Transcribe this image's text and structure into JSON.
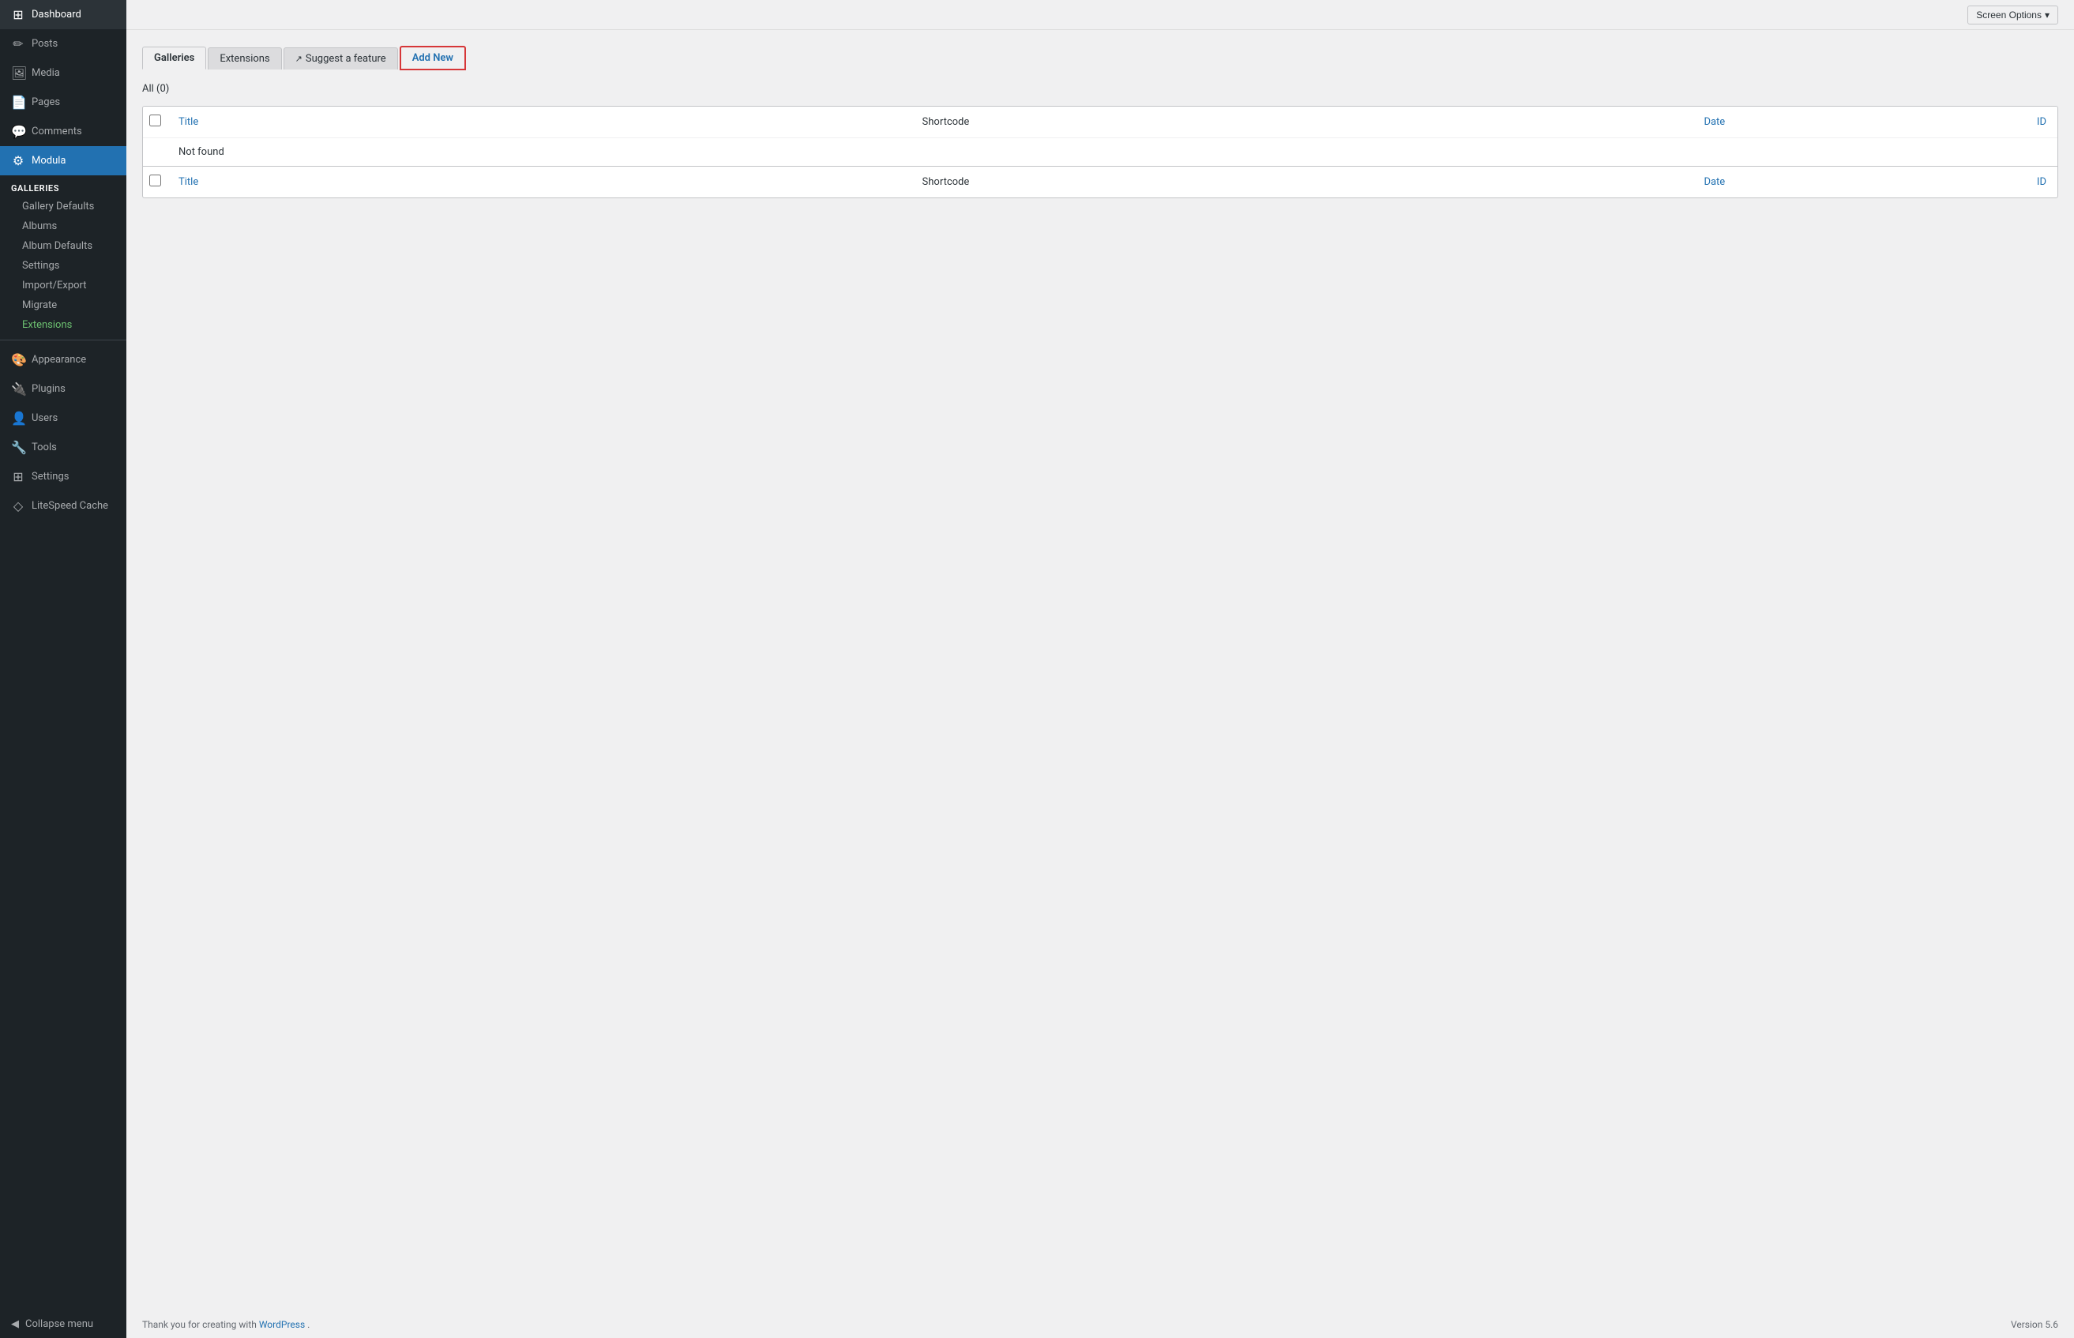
{
  "sidebar": {
    "items": [
      {
        "id": "dashboard",
        "label": "Dashboard",
        "icon": "⊞"
      },
      {
        "id": "posts",
        "label": "Posts",
        "icon": "📝"
      },
      {
        "id": "media",
        "label": "Media",
        "icon": "🖼"
      },
      {
        "id": "pages",
        "label": "Pages",
        "icon": "📄"
      },
      {
        "id": "comments",
        "label": "Comments",
        "icon": "💬"
      },
      {
        "id": "modula",
        "label": "Modula",
        "icon": "⚙",
        "active": true
      }
    ],
    "modula_group": {
      "title": "Galleries",
      "subitems": [
        {
          "id": "gallery-defaults",
          "label": "Gallery Defaults"
        },
        {
          "id": "albums",
          "label": "Albums"
        },
        {
          "id": "album-defaults",
          "label": "Album Defaults"
        },
        {
          "id": "settings",
          "label": "Settings"
        },
        {
          "id": "import-export",
          "label": "Import/Export"
        },
        {
          "id": "migrate",
          "label": "Migrate"
        },
        {
          "id": "extensions",
          "label": "Extensions",
          "special": "extensions"
        }
      ]
    },
    "bottom_items": [
      {
        "id": "appearance",
        "label": "Appearance",
        "icon": "🎨"
      },
      {
        "id": "plugins",
        "label": "Plugins",
        "icon": "🔌"
      },
      {
        "id": "users",
        "label": "Users",
        "icon": "👤"
      },
      {
        "id": "tools",
        "label": "Tools",
        "icon": "🔧"
      },
      {
        "id": "settings",
        "label": "Settings",
        "icon": "⊞"
      },
      {
        "id": "litespeed",
        "label": "LiteSpeed Cache",
        "icon": "◇"
      }
    ],
    "collapse_label": "Collapse menu"
  },
  "topbar": {
    "screen_options_label": "Screen Options",
    "screen_options_arrow": "▾"
  },
  "tabs": [
    {
      "id": "galleries",
      "label": "Galleries",
      "active": true
    },
    {
      "id": "extensions",
      "label": "Extensions",
      "active": false
    },
    {
      "id": "suggest",
      "label": "Suggest a feature",
      "icon": "↗",
      "active": false
    },
    {
      "id": "add-new",
      "label": "Add New",
      "active": false,
      "highlighted": true
    }
  ],
  "table": {
    "all_label": "All",
    "all_count": "(0)",
    "columns": {
      "title": "Title",
      "shortcode": "Shortcode",
      "date": "Date",
      "id": "ID"
    },
    "not_found": "Not found"
  },
  "footer": {
    "thank_you_text": "Thank you for creating with",
    "wordpress_link": "WordPress",
    "version_label": "Version 5.6"
  }
}
